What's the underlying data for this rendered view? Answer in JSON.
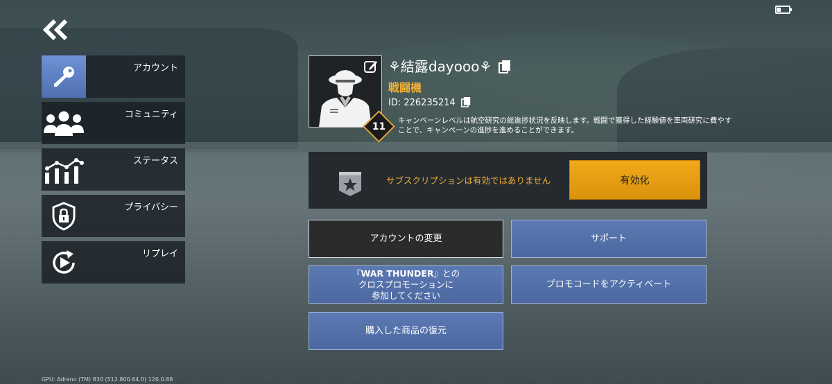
{
  "header": {
    "back_icon": "double-chevron-left-icon",
    "battery_icon": "battery-low-icon"
  },
  "sidebar": {
    "items": [
      {
        "label": "アカウント",
        "icon": "key-icon",
        "active": true
      },
      {
        "label": "コミュニティ",
        "icon": "people-icon",
        "active": false
      },
      {
        "label": "ステータス",
        "icon": "stats-chart-icon",
        "active": false
      },
      {
        "label": "プライバシー",
        "icon": "shield-lock-icon",
        "active": false
      },
      {
        "label": "リプレイ",
        "icon": "replay-play-icon",
        "active": false
      }
    ]
  },
  "profile": {
    "username": "⚘結露dayooo⚘",
    "rank": "戦闘機",
    "id_text": "ID: 226235214",
    "level": "11",
    "level_description": "キャンペーンレベルは航空研究の総進捗状況を反映します。戦闘で獲得した経験値を車両研究に費やすことで、キャンペーンの進捗を進めることができます。"
  },
  "subscription": {
    "status_text": "サブスクリプションは有効ではありません",
    "activate_label": "有効化"
  },
  "actions": {
    "change_account": "アカウントの変更",
    "support": "サポート",
    "wt_promo_line1_prefix": "『",
    "wt_promo_line1_bold": "WAR THUNDER",
    "wt_promo_line1_suffix": "』との",
    "wt_promo_line2": "クロスプロモーションに",
    "wt_promo_line3": "参加してください",
    "activate_promo": "プロモコードをアクティベート",
    "restore_purchases": "購入した商品の復元"
  },
  "footer": {
    "gpu_info": "GPU: Adreno (TM) 830 (512.800.64.0)   126.0.88"
  },
  "colors": {
    "accent_gold": "#f0b035",
    "button_blue": "#5470a8",
    "active_blue": "#6486cc"
  }
}
